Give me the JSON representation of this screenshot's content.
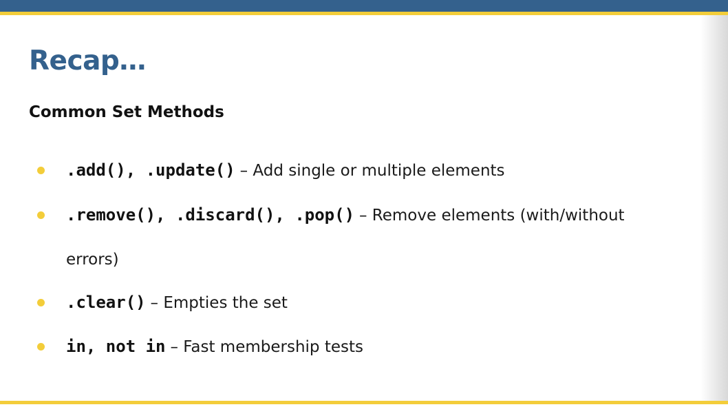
{
  "slide": {
    "title": "Recap…",
    "subtitle": "Common Set Methods"
  },
  "bullets": [
    {
      "code": ".add(), .update()",
      "desc": "– Add single or multiple elements"
    },
    {
      "code": ".remove(), .discard(), .pop()",
      "desc": "– Remove elements (with/without",
      "desc_cont": "errors)"
    },
    {
      "code": ".clear()",
      "desc": "– Empties the set"
    },
    {
      "code": "in, not in",
      "desc": "– Fast membership tests"
    }
  ],
  "colors": {
    "header_blue": "#34618d",
    "accent_yellow": "#f3cd3a"
  }
}
